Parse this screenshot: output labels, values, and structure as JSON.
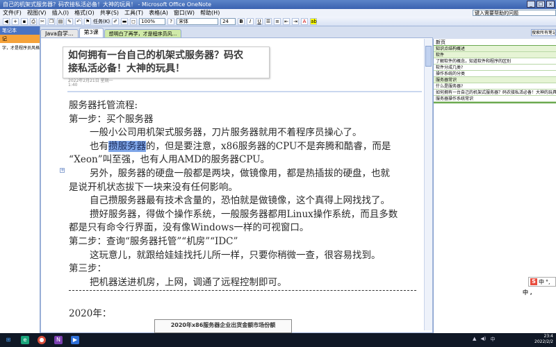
{
  "window": {
    "title": "自己的机架式服务器？码农接私活必备！大神的玩具！ - Microsoft Office OneNote"
  },
  "menu": {
    "items": [
      "文件(F)",
      "视图(V)",
      "插入(I)",
      "格式(O)",
      "共享(S)",
      "工具(T)",
      "表格(A)",
      "窗口(W)",
      "帮助(H)"
    ],
    "help_placeholder": "键入需要帮助的问题"
  },
  "toolbar": {
    "task_label": "任务(K)",
    "zoom": "100%",
    "font": "宋体",
    "size": "24"
  },
  "left_panel": {
    "header": "笔记本",
    "section": "记",
    "item": "字，才是程序员风格"
  },
  "tabs": [
    {
      "label": "Java自学..."
    },
    {
      "label": "第3课"
    },
    {
      "label": "想明白了再学，才是程序员风..."
    }
  ],
  "search_all_label": "搜索所有笔记本",
  "page": {
    "title": "如何拥有一台自己的机架式服务器？码农接私活必备！大神的玩具！",
    "title_line1": "如何拥有一台自己的机架式服务器？码农",
    "title_line2": "接私活必备！大神的玩具！",
    "date": "2022年2月21日 星期一",
    "time": "1:40",
    "lines": {
      "l1": "服务器托管流程:",
      "l2": "第一步：买个服务器",
      "l3": "一般小公司用机架式服务器，刀片服务器就用不着程序员操心了。",
      "l4_pre": "也有",
      "l4_hl": "攒服务器",
      "l4_post": "的，但是要注意，x86服务器的CPU不是奔腾和酷睿，而是",
      "l5": "“Xeon”叫至强，也有人用AMD的服务器CPU。",
      "l6": "另外，服务器的硬盘一般都是两块，做镜像用，都是热插拔的硬盘，也就",
      "l7": "是说开机状态拔下一块来没有任何影响。",
      "l8": "自己攒服务器最有技术含量的，恐怕就是做镜像，这个真得上网找找了。",
      "l9": "攒好服务器，得做个操作系统，一般服务器都用Linux操作系统，而且多数",
      "l10": "都是只有命令行界面，没有像Windows一样的可视窗口。",
      "l11": "第二步：查询“服务器托管”“机房”“IDC”",
      "l12": "这玩意儿，就跟给娃娃找托儿所一样，只要你稍微一查，很容易找到。",
      "l13": "第三步：",
      "l14": "把机器送进机房，上网，调通了远程控制即可。"
    },
    "year": "2020年：",
    "table_caption": "2020年x86服务器企业出货金额市场份额"
  },
  "right_panel": {
    "new_page": "新页",
    "items": [
      "知识点结构概述",
      "软件",
      "了解软件的概念，知道软件和程序的区别",
      "软件分成几类?",
      "操作系统的分类",
      "服务器常识",
      "什么是服务器?",
      "如何拥有一台自己的机架式服务器？码农接私活必备！大神的玩具",
      "服务器操作系统常识"
    ]
  },
  "ime": {
    "logo": "S",
    "mode": "中",
    "punct": "°,"
  },
  "ime_mode_label": "中 ,",
  "taskbar": {
    "time": "23:4",
    "date": "2022/2/2"
  }
}
